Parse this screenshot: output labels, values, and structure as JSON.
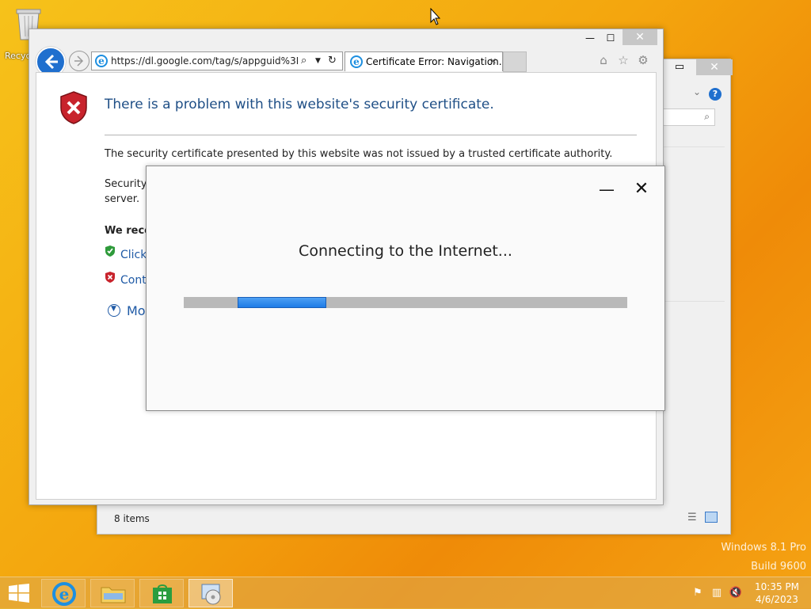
{
  "desktop": {
    "recycle_bin_label": "Recyc"
  },
  "explorer": {
    "status_items": "8 items",
    "min_glyph": "▭",
    "close_glyph": "✕",
    "help_glyph": "?"
  },
  "ie": {
    "address_url": "https://dl.google.com/tag/s/appguid%3D%7",
    "tab_title": "Certificate Error: Navigation...",
    "min_glyph": "—",
    "max_glyph": "☐",
    "close_glyph": "✕",
    "icons": [
      "home-icon",
      "favorites-star-icon",
      "settings-gear-icon"
    ]
  },
  "cert_error": {
    "title": "There is a problem with this website's security certificate.",
    "line1": "The security certificate presented by this website was not issued by a trusted certificate authority.",
    "line2_visible": "Security c",
    "line2_cont": "server.",
    "recommend": "We recon",
    "click_here": "Click h",
    "continue": "Contin",
    "more_info": "More"
  },
  "dialog": {
    "message": "Connecting to the Internet...",
    "min_glyph": "—",
    "close_glyph": "✕",
    "progress_fraction": 0.2
  },
  "watermark": {
    "line1": "Windows 8.1 Pro",
    "line2": "Build 9600"
  },
  "taskbar": {
    "items": [
      "internet-explorer",
      "file-explorer",
      "store",
      "setup-app"
    ],
    "time": "10:35 PM",
    "date": "4/6/2023"
  },
  "colors": {
    "accent_blue": "#1f6fce",
    "link_blue": "#1f5aa6",
    "title_blue": "#1f4f86",
    "progress_blue": "#2e86ec",
    "shield_red": "#c8232c"
  }
}
